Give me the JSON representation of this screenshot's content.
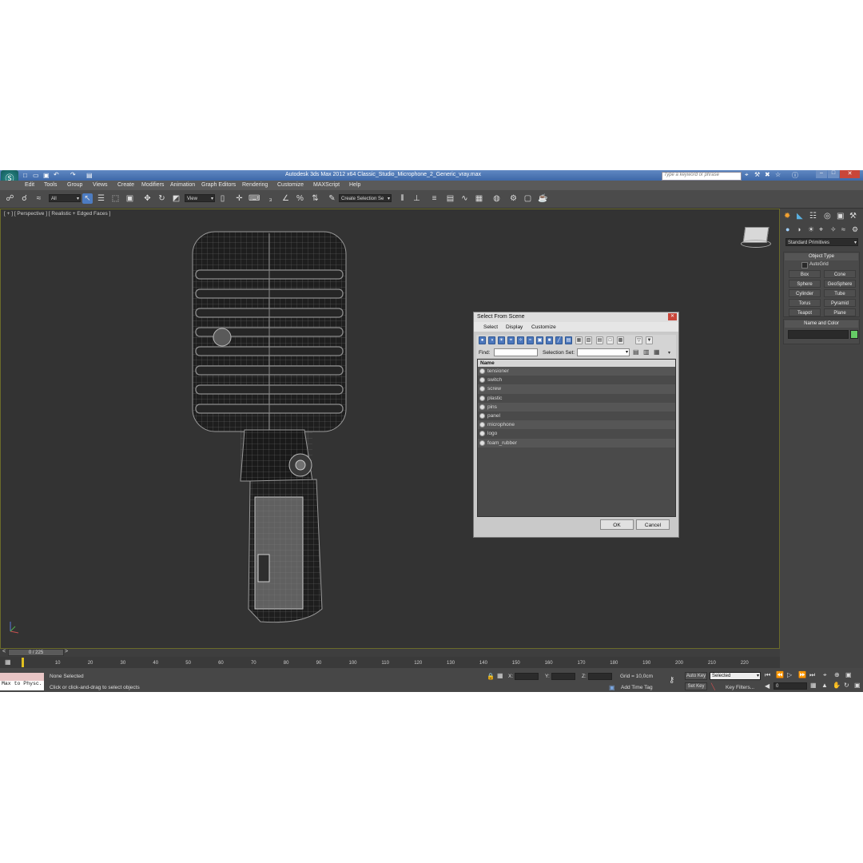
{
  "window": {
    "title": "Autodesk 3ds Max  2012 x64      Classic_Studio_Microphone_2_Generic_vray.max",
    "search_placeholder": "Type a keyword or phrase"
  },
  "menu": [
    "Edit",
    "Tools",
    "Group",
    "Views",
    "Create",
    "Modifiers",
    "Animation",
    "Graph Editors",
    "Rendering",
    "Customize",
    "MAXScript",
    "Help"
  ],
  "toolbar": {
    "filter_value": "All",
    "coord_value": "View",
    "selection_set_value": "Create Selection Se"
  },
  "viewport": {
    "label": "[ + ] [ Perspective ] [ Realistic + Edged Faces ]"
  },
  "command_panel": {
    "dropdown_value": "Standard Primitives",
    "object_type_header": "Object Type",
    "autogrid_label": "AutoGrid",
    "primitives": [
      "Box",
      "Cone",
      "Sphere",
      "GeoSphere",
      "Cylinder",
      "Tube",
      "Torus",
      "Pyramid",
      "Teapot",
      "Plane"
    ],
    "name_color_header": "Name and Color",
    "object_color": "#66cc66"
  },
  "dialog": {
    "title": "Select From Scene",
    "menu": [
      "Select",
      "Display",
      "Customize"
    ],
    "find_label": "Find:",
    "selection_set_label": "Selection Set:",
    "column_name": "Name",
    "objects": [
      "tensioner",
      "switch",
      "screw",
      "plastic",
      "pins",
      "panel",
      "microphone",
      "logo",
      "foam_rubber"
    ],
    "ok_label": "OK",
    "cancel_label": "Cancel"
  },
  "timeline": {
    "frame_display": "0 / 225",
    "ticks": [
      "0",
      "10",
      "20",
      "30",
      "40",
      "50",
      "60",
      "70",
      "80",
      "90",
      "100",
      "110",
      "120",
      "130",
      "140",
      "150",
      "160",
      "170",
      "180",
      "190",
      "200",
      "210",
      "220"
    ]
  },
  "status": {
    "maxscript_label": "Max to Physc.",
    "selection_text": "None Selected",
    "prompt_text": "Click or click-and-drag to select objects",
    "x_label": "X:",
    "y_label": "Y:",
    "z_label": "Z:",
    "grid_text": "Grid = 10,0cm",
    "add_time_tag": "Add Time Tag",
    "auto_key": "Auto Key",
    "auto_key_value": "Selected",
    "set_key": "Set Key",
    "key_filters": "Key Filters...",
    "frame_value": "0"
  }
}
